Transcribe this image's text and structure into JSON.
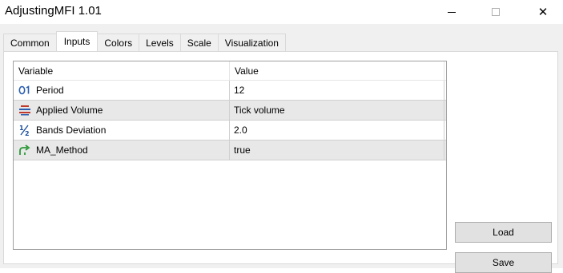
{
  "window": {
    "title": "AdjustingMFI 1.01",
    "close_glyph": "✕"
  },
  "tabs": [
    {
      "label": "Common",
      "active": false
    },
    {
      "label": "Inputs",
      "active": true
    },
    {
      "label": "Colors",
      "active": false
    },
    {
      "label": "Levels",
      "active": false
    },
    {
      "label": "Scale",
      "active": false
    },
    {
      "label": "Visualization",
      "active": false
    }
  ],
  "table": {
    "headers": {
      "variable": "Variable",
      "value": "Value"
    },
    "rows": [
      {
        "icon": "integer-icon",
        "variable": "Period",
        "value": "12"
      },
      {
        "icon": "enum-list-icon",
        "variable": "Applied Volume",
        "value": "Tick volume"
      },
      {
        "icon": "fraction-icon",
        "variable": "Bands Deviation",
        "value": "2.0"
      },
      {
        "icon": "boolean-arrow-icon",
        "variable": "MA_Method",
        "value": "true"
      }
    ]
  },
  "buttons": {
    "load": "Load",
    "save": "Save"
  },
  "colors": {
    "integer_icon": "#2a5db0",
    "enum_icon": "#c0392b",
    "fraction_icon": "#1a4f9c",
    "bool_icon": "#2e9a3a"
  }
}
